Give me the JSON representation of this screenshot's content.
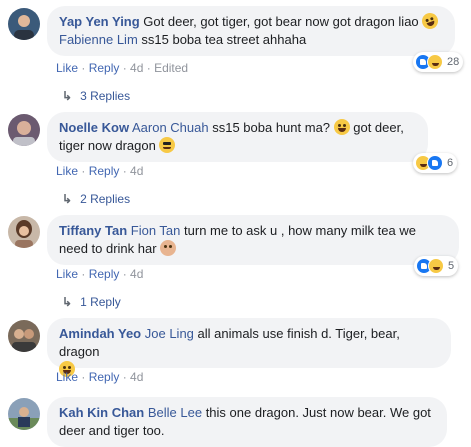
{
  "comments": [
    {
      "author": "Yap Yen Ying",
      "text_1": " Got deer, got tiger, got bear now got dragon liao ",
      "mention": "Fabienne Lim",
      "text_2": " ss15 boba tea street ahhaha",
      "like": "Like",
      "reply": "Reply",
      "time": "4d",
      "edited": "Edited",
      "reaction_count": "28",
      "replies_label": "3 Replies",
      "avatar_color": "#3b5a7a"
    },
    {
      "author": "Noelle Kow",
      "mention": "Aaron Chuah",
      "text_1": " ss15 boba hunt ma? ",
      "text_2": " got deer, tiger now dragon ",
      "like": "Like",
      "reply": "Reply",
      "time": "4d",
      "reaction_count": "6",
      "replies_label": "2 Replies",
      "avatar_color": "#6b5a70"
    },
    {
      "author": "Tiffany Tan",
      "mention": "Fion Tan",
      "text_1": " turn me to ask u , how many milk tea we need to drink har ",
      "like": "Like",
      "reply": "Reply",
      "time": "4d",
      "reaction_count": "5",
      "replies_label": "1 Reply",
      "avatar_color": "#9a7560"
    },
    {
      "author": "Amindah Yeo",
      "mention": "Joe Ling",
      "text_1": " all animals use finish d. Tiger, bear, dragon",
      "like": "Like",
      "reply": "Reply",
      "time": "4d",
      "avatar_color": "#5a4a3a"
    },
    {
      "author": "Kah Kin Chan",
      "mention": "Belle Lee",
      "text_1": " this one dragon. Just now bear. We got deer and tiger too.",
      "avatar_color": "#4d6a8a"
    }
  ],
  "colors": {
    "link": "#385898",
    "bubble": "#f2f3f5",
    "meta": "#90949c"
  }
}
